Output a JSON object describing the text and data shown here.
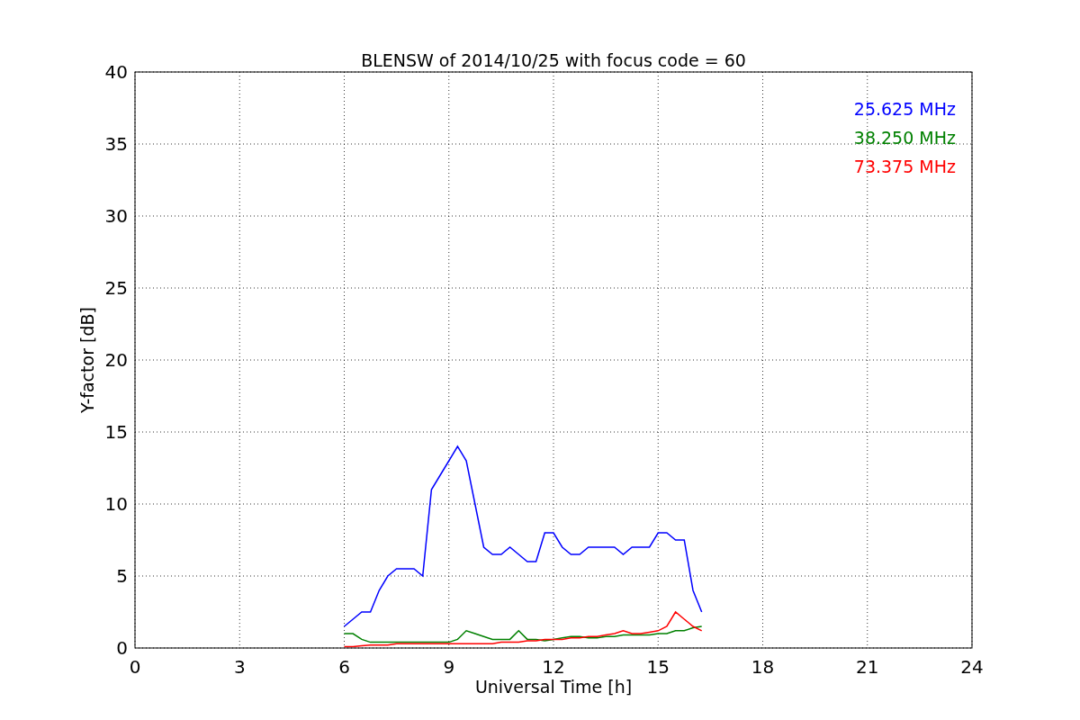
{
  "chart_data": {
    "type": "line",
    "title": "BLENSW of 2014/10/25 with focus code = 60",
    "xlabel": "Universal Time [h]",
    "ylabel": "Y-factor [dB]",
    "grid": true,
    "xlim": [
      0,
      24
    ],
    "ylim": [
      0,
      40
    ],
    "xticks": [
      0,
      3,
      6,
      9,
      12,
      15,
      18,
      21,
      24
    ],
    "yticks": [
      0,
      5,
      10,
      15,
      20,
      25,
      30,
      35,
      40
    ],
    "x": [
      6,
      6.25,
      6.5,
      6.75,
      7,
      7.25,
      7.5,
      7.75,
      8,
      8.25,
      8.5,
      8.75,
      9,
      9.25,
      9.5,
      9.75,
      10,
      10.25,
      10.5,
      10.75,
      11,
      11.25,
      11.5,
      11.75,
      12,
      12.25,
      12.5,
      12.75,
      13,
      13.25,
      13.5,
      13.75,
      14,
      14.25,
      14.5,
      14.75,
      15,
      15.25,
      15.5,
      15.75,
      16,
      16.25
    ],
    "series": [
      {
        "name": "25.625 MHz",
        "color": "#0000ff",
        "values": [
          1.5,
          2,
          2.5,
          2.5,
          4,
          5,
          5.5,
          5.5,
          5.5,
          5,
          11,
          12,
          13,
          14,
          13,
          10,
          7,
          6.5,
          6.5,
          7,
          6.5,
          6,
          6,
          8,
          8,
          7,
          6.5,
          6.5,
          7,
          7,
          7,
          7,
          6.5,
          7,
          7,
          7,
          8,
          8,
          7.5,
          7.5,
          4,
          2.5
        ]
      },
      {
        "name": "38.250 MHz",
        "color": "#008000",
        "values": [
          1,
          1,
          0.6,
          0.4,
          0.4,
          0.4,
          0.4,
          0.4,
          0.4,
          0.4,
          0.4,
          0.4,
          0.4,
          0.6,
          1.2,
          1,
          0.8,
          0.6,
          0.6,
          0.6,
          1.2,
          0.6,
          0.6,
          0.5,
          0.6,
          0.7,
          0.8,
          0.8,
          0.7,
          0.7,
          0.8,
          0.8,
          0.9,
          0.9,
          0.9,
          0.9,
          1,
          1,
          1.2,
          1.2,
          1.4,
          1.5
        ]
      },
      {
        "name": "73.375 MHz",
        "color": "#ff0000",
        "values": [
          0.1,
          0.1,
          0.15,
          0.2,
          0.2,
          0.2,
          0.3,
          0.3,
          0.3,
          0.3,
          0.3,
          0.3,
          0.3,
          0.3,
          0.3,
          0.3,
          0.3,
          0.3,
          0.4,
          0.4,
          0.4,
          0.5,
          0.5,
          0.6,
          0.6,
          0.6,
          0.7,
          0.7,
          0.8,
          0.8,
          0.9,
          1,
          1.2,
          1,
          1,
          1.1,
          1.2,
          1.5,
          2.5,
          2,
          1.5,
          1.2
        ]
      }
    ]
  }
}
